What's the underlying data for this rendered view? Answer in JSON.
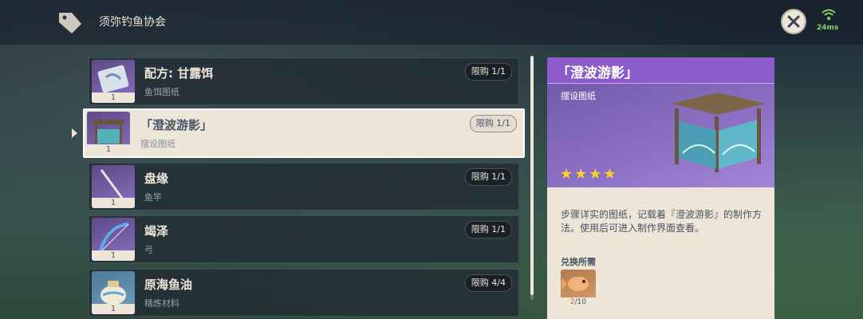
{
  "header": {
    "title": "须弥钓鱼协会",
    "ping": "24ms"
  },
  "items": [
    {
      "name": "配方: 甘露饵",
      "sub": "鱼饵图纸",
      "limit": "限购 1/1",
      "count": "1"
    },
    {
      "name": "「澄波游影」",
      "sub": "摆设图纸",
      "limit": "限购 1/1",
      "count": "1"
    },
    {
      "name": "盘缘",
      "sub": "鱼竿",
      "limit": "限购 1/1",
      "count": "1"
    },
    {
      "name": "竭泽",
      "sub": "弓",
      "limit": "限购 1/1",
      "count": "1"
    },
    {
      "name": "原海鱼油",
      "sub": "精炼材料",
      "limit": "限购 4/4",
      "count": "1"
    }
  ],
  "detail": {
    "title": "「澄波游影」",
    "type": "摆设图纸",
    "stars": "★★★★",
    "description": "步骤详实的图纸，记载着『澄波游影』的制作方法。使用后可进入制作界面查看。",
    "req_label": "兑换所需",
    "req_have": "2",
    "req_need": "/10"
  },
  "colors": {
    "accent": "#8b5cc9",
    "panel": "#ece5d8",
    "star": "#ffcc32"
  }
}
